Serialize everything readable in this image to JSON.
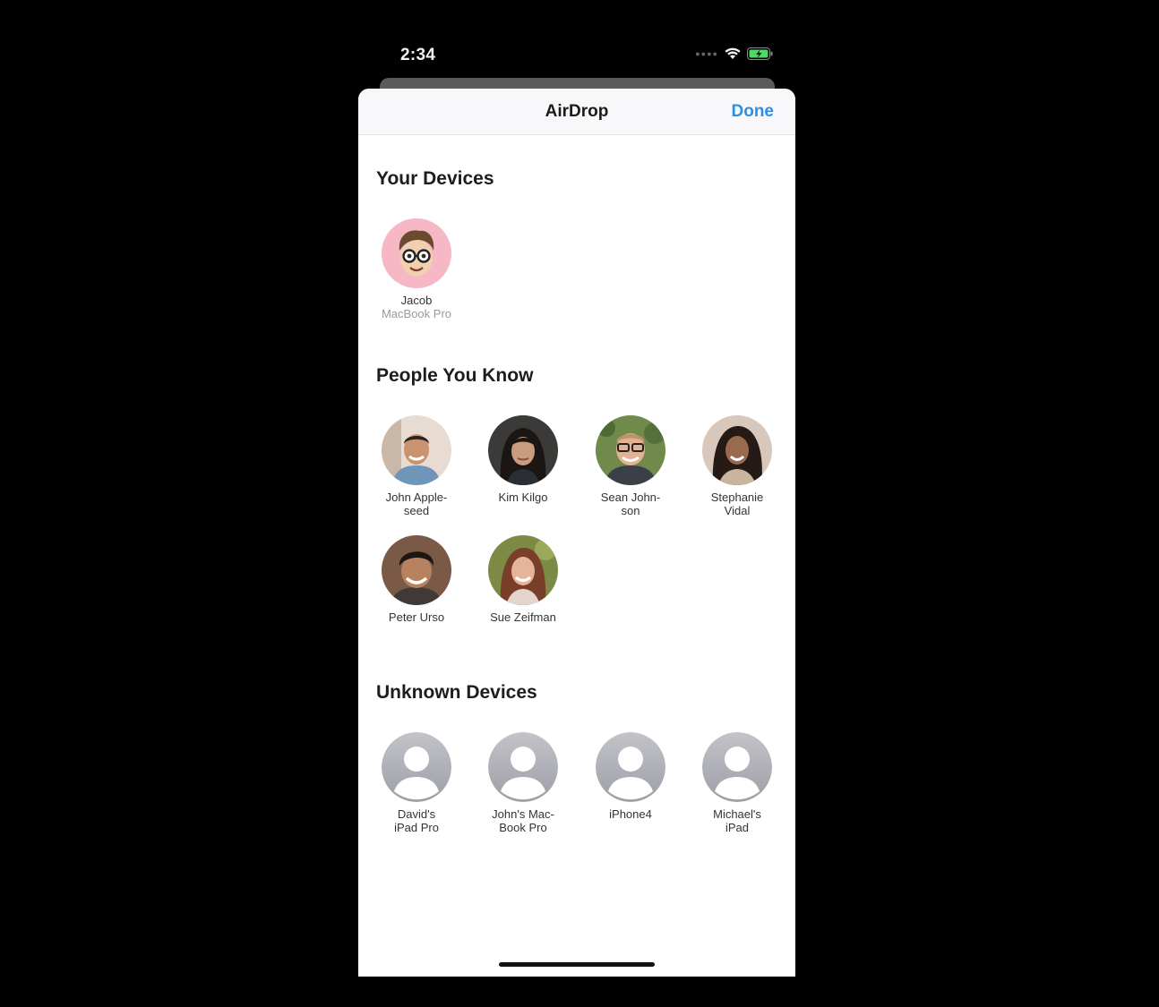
{
  "status_bar": {
    "time": "2:34",
    "icons": [
      "signal-dots-icon",
      "wifi-icon",
      "battery-charging-icon"
    ],
    "battery_color": "#4cd964"
  },
  "nav": {
    "title": "AirDrop",
    "done_label": "Done",
    "accent_color": "#2f8fdd"
  },
  "sections": {
    "your_devices": {
      "title": "Your Devices",
      "items": [
        {
          "name": "Jacob",
          "subtitle": "MacBook Pro",
          "avatar": "memoji-avatar"
        }
      ]
    },
    "people_you_know": {
      "title": "People You Know",
      "items": [
        {
          "name_line1": "John Apple-",
          "name_line2": "seed",
          "avatar": "photo-avatar"
        },
        {
          "name_line1": "Kim Kilgo",
          "name_line2": "",
          "avatar": "photo-avatar"
        },
        {
          "name_line1": "Sean John-",
          "name_line2": "son",
          "avatar": "photo-avatar"
        },
        {
          "name_line1": "Stephanie",
          "name_line2": "Vidal",
          "avatar": "photo-avatar"
        },
        {
          "name_line1": "Peter Urso",
          "name_line2": "",
          "avatar": "photo-avatar"
        },
        {
          "name_line1": "Sue Zeifman",
          "name_line2": "",
          "avatar": "photo-avatar"
        }
      ]
    },
    "unknown_devices": {
      "title": "Unknown Devices",
      "items": [
        {
          "name_line1": "David's",
          "name_line2": "iPad Pro",
          "avatar": "generic-person-icon"
        },
        {
          "name_line1": "John's Mac-",
          "name_line2": "Book Pro",
          "avatar": "generic-person-icon"
        },
        {
          "name_line1": "iPhone4",
          "name_line2": "",
          "avatar": "generic-person-icon"
        },
        {
          "name_line1": "Michael's",
          "name_line2": "iPad",
          "avatar": "generic-person-icon"
        }
      ]
    }
  }
}
